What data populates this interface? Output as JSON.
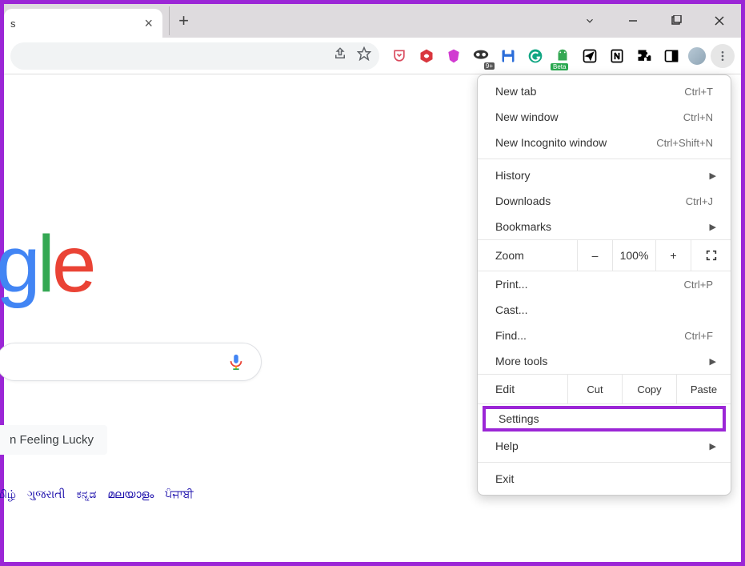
{
  "tab": {
    "title": "s"
  },
  "toolbar": {
    "extensions": {
      "beta_badge": "Beta",
      "nine_plus": "9+"
    }
  },
  "page": {
    "logo_fragment": {
      "g": "g",
      "l": "l",
      "e": "e"
    },
    "lucky": "n Feeling Lucky",
    "languages": [
      "மிழ்",
      "ગુજરાતી",
      "ಕನ್ನಡ",
      "മലയാളം",
      "ਪੰਜਾਬੀ"
    ]
  },
  "menu": {
    "new_tab": {
      "label": "New tab",
      "shortcut": "Ctrl+T"
    },
    "new_window": {
      "label": "New window",
      "shortcut": "Ctrl+N"
    },
    "new_incognito": {
      "label": "New Incognito window",
      "shortcut": "Ctrl+Shift+N"
    },
    "history": {
      "label": "History"
    },
    "downloads": {
      "label": "Downloads",
      "shortcut": "Ctrl+J"
    },
    "bookmarks": {
      "label": "Bookmarks"
    },
    "zoom": {
      "label": "Zoom",
      "minus": "–",
      "percent": "100%",
      "plus": "+"
    },
    "print": {
      "label": "Print...",
      "shortcut": "Ctrl+P"
    },
    "cast": {
      "label": "Cast..."
    },
    "find": {
      "label": "Find...",
      "shortcut": "Ctrl+F"
    },
    "more_tools": {
      "label": "More tools"
    },
    "edit": {
      "label": "Edit",
      "cut": "Cut",
      "copy": "Copy",
      "paste": "Paste"
    },
    "settings": {
      "label": "Settings"
    },
    "help": {
      "label": "Help"
    },
    "exit": {
      "label": "Exit"
    }
  }
}
